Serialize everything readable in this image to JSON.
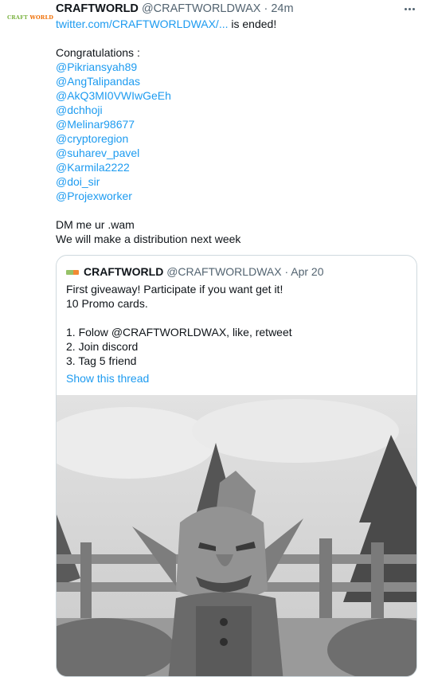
{
  "tweet": {
    "avatar_text_a": "CRAFT",
    "avatar_text_b": "WORLD",
    "name": "CRAFTWORLD",
    "handle": "@CRAFTWORLDWAX",
    "separator": "·",
    "time": "24m",
    "link_text": "twitter.com/CRAFTWORLDWAX/...",
    "after_link": " is ended!",
    "congrats": "Congratulations :",
    "mentions": [
      "@Pikriansyah89",
      "@AngTalipandas",
      "@AkQ3MI0VWIwGeEh",
      "@dchhoji",
      "@Melinar98677",
      "@cryptoregion",
      "@suharev_pavel",
      "@Karmila2222",
      "@doi_sir",
      "@Projexworker"
    ],
    "dm_line": "DM me ur .wam",
    "distribution_line": "We will make a distribution next week"
  },
  "quote": {
    "name": "CRAFTWORLD",
    "handle": "@CRAFTWORLDWAX",
    "separator": "·",
    "date": "Apr 20",
    "line1": "First giveaway! Participate if you want get it!",
    "line2": "10 Promo cards.",
    "step1_prefix": "1. Folow ",
    "step1_mention": "@CRAFTWORLDWAX",
    "step1_suffix": ", like, retweet",
    "step2": "2. Join discord",
    "step3": "3. Tag 5 friend",
    "show_thread": "Show this thread"
  },
  "colors": {
    "link": "#1d9bf0",
    "secondary_text": "#536471",
    "border": "#cfd9de"
  }
}
